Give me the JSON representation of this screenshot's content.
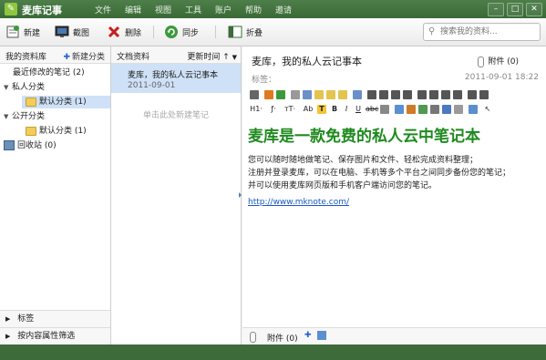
{
  "app": {
    "title": "麦库记事"
  },
  "menu": [
    "文件",
    "编辑",
    "视图",
    "工具",
    "账户",
    "帮助",
    "邀请"
  ],
  "toolbar": {
    "new_label": "新建",
    "screenshot_label": "截图",
    "delete_label": "删除",
    "sync_label": "同步",
    "collapse_label": "折叠",
    "search_placeholder": "搜索我的资料..."
  },
  "sidebar": {
    "header": "我的资料库",
    "new_category": "新建分类",
    "recent": "最近修改的笔记 (2)",
    "private_group": "私人分类",
    "private_default": "默认分类 (1)",
    "public_group": "公开分类",
    "public_default": "默认分类 (1)",
    "trash": "回收站 (0)",
    "tags": "标签",
    "filter": "按内容属性筛选"
  },
  "notelist": {
    "header": "文档资料",
    "sort": "更新时间 ↑",
    "items": [
      {
        "title": "麦库，我的私人云记事本",
        "date": "2011-09-01"
      }
    ],
    "hint": "单击此处新建笔记"
  },
  "editor": {
    "title": "麦库，我的私人云记事本",
    "attach_count": "附件 (0)",
    "tag_label": "标签：",
    "date": "2011-09-01 18:22",
    "heading": "麦库是一款免费的私人云中笔记本",
    "lines": [
      "您可以随时随地做笔记、保存图片和文件、轻松完成资料整理；",
      "注册并登录麦库，可以在电脑、手机等多个平台之间同步备份您的笔记；",
      "并可以使用麦库网页版和手机客户端访问您的笔记。"
    ],
    "link": "http://www.mknote.com/",
    "bottom_attach": "附件 (0)",
    "fmt_row2": {
      "h1": "H1·",
      "font": "ƒ·",
      "size": "тT·",
      "ab": "Ab"
    }
  },
  "colors": {
    "accent": "#3d6b3a",
    "heading": "#1f8a1f",
    "selection": "#cfe1f7",
    "link": "#1a56c5"
  }
}
